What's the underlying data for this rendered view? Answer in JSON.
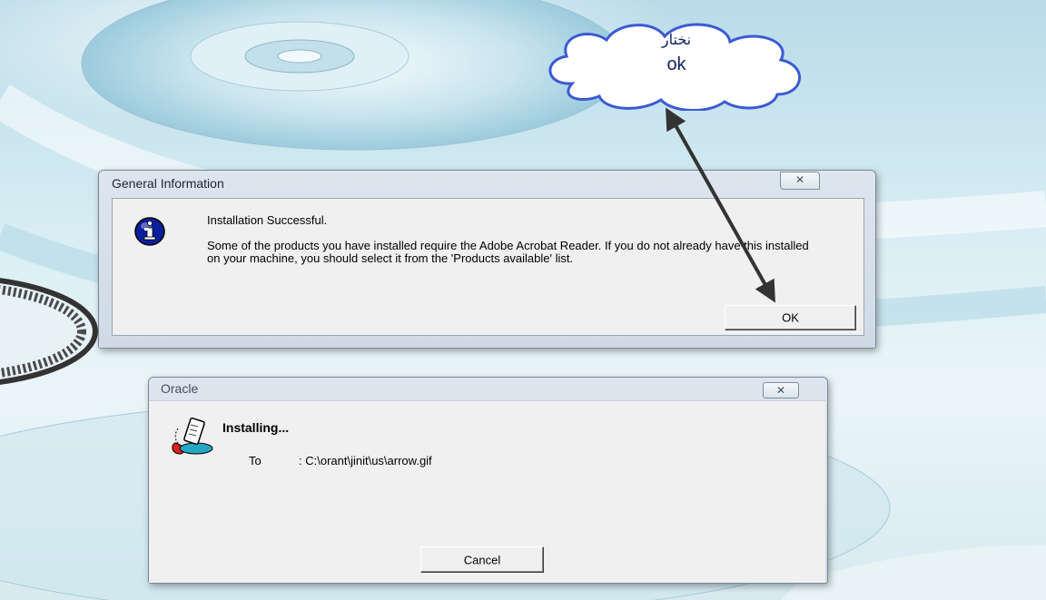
{
  "colors": {
    "desktop_top": "#b9dbe8",
    "desktop_bottom": "#eaf5f8",
    "window_face": "#f0f0f0",
    "cloud_fill": "#ffffff",
    "cloud_border": "#3c5ad2",
    "callout_text": "#102060",
    "info_icon": "#0b1f9a"
  },
  "general_info": {
    "title": "General Information",
    "close_glyph": "✕",
    "icon": "info-icon",
    "message_line1": "Installation Successful.",
    "message_line2": "Some of the products you have installed require the Adobe Acrobat Reader.  If you do not already have this installed on your machine, you should select it from the 'Products available' list.",
    "ok_label": "OK"
  },
  "oracle": {
    "title": "Oracle",
    "close_glyph": "✕",
    "icon": "installer-icon",
    "heading": "Installing...",
    "to_label": "To",
    "path": ": C:\\orant\\jinit\\us\\arrow.gif",
    "cancel_label": "Cancel"
  },
  "callout": {
    "line1": "نختار",
    "line2": "ok"
  }
}
